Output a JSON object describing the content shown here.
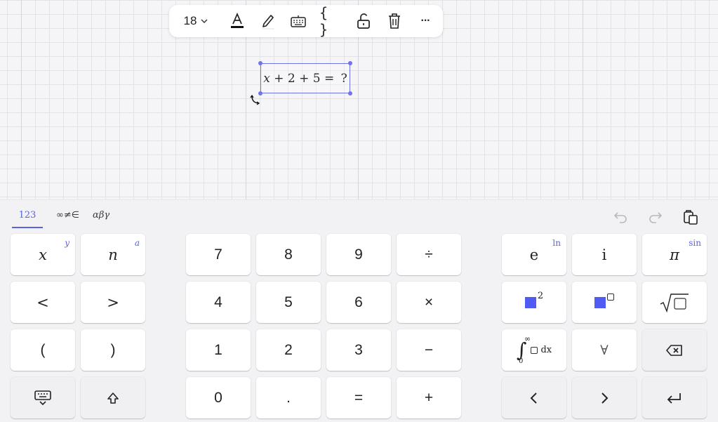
{
  "toolbar": {
    "font_size": "18",
    "font_size_chevron": "⌄",
    "icons": [
      "text-color-icon",
      "highlight-pen-icon",
      "keyboard-icon",
      "braces-icon",
      "unlock-icon",
      "trash-icon",
      "more-icon"
    ],
    "braces_label": "{ }",
    "more_label": "···"
  },
  "math_element": {
    "parts": {
      "x": "x",
      "rest": " + 2 + 5 = ",
      "placeholder": "?"
    },
    "selection_color": "#6f74e8"
  },
  "keyboard": {
    "tabs": [
      {
        "label": "123",
        "active": true
      },
      {
        "label": "∞≠∈",
        "active": false
      },
      {
        "label": "αβγ",
        "active": false
      }
    ],
    "actions": [
      "undo-icon",
      "redo-icon",
      "clipboard-icon"
    ],
    "left_keys": [
      {
        "label": "x",
        "sup": "y"
      },
      {
        "label": "n",
        "sup": "a"
      },
      {
        "label": "<"
      },
      {
        "label": ">"
      },
      {
        "label": "("
      },
      {
        "label": ")"
      }
    ],
    "num_keys": [
      {
        "label": "7"
      },
      {
        "label": "8"
      },
      {
        "label": "9"
      },
      {
        "label": "÷"
      },
      {
        "label": "4"
      },
      {
        "label": "5"
      },
      {
        "label": "6"
      },
      {
        "label": "×"
      },
      {
        "label": "1"
      },
      {
        "label": "2"
      },
      {
        "label": "3"
      },
      {
        "label": "−"
      },
      {
        "label": "0"
      },
      {
        "label": "."
      },
      {
        "label": "="
      },
      {
        "label": "+"
      }
    ],
    "right_keys": {
      "e": {
        "label": "e",
        "sup": "ln"
      },
      "i": {
        "label": "i"
      },
      "pi": {
        "label": "π",
        "sup": "sin"
      },
      "square_exp": "2",
      "integral": {
        "upper": "∞",
        "lower": "0",
        "tail": "dx"
      },
      "forall": "∀"
    },
    "accent_color": "#5a61e6"
  }
}
